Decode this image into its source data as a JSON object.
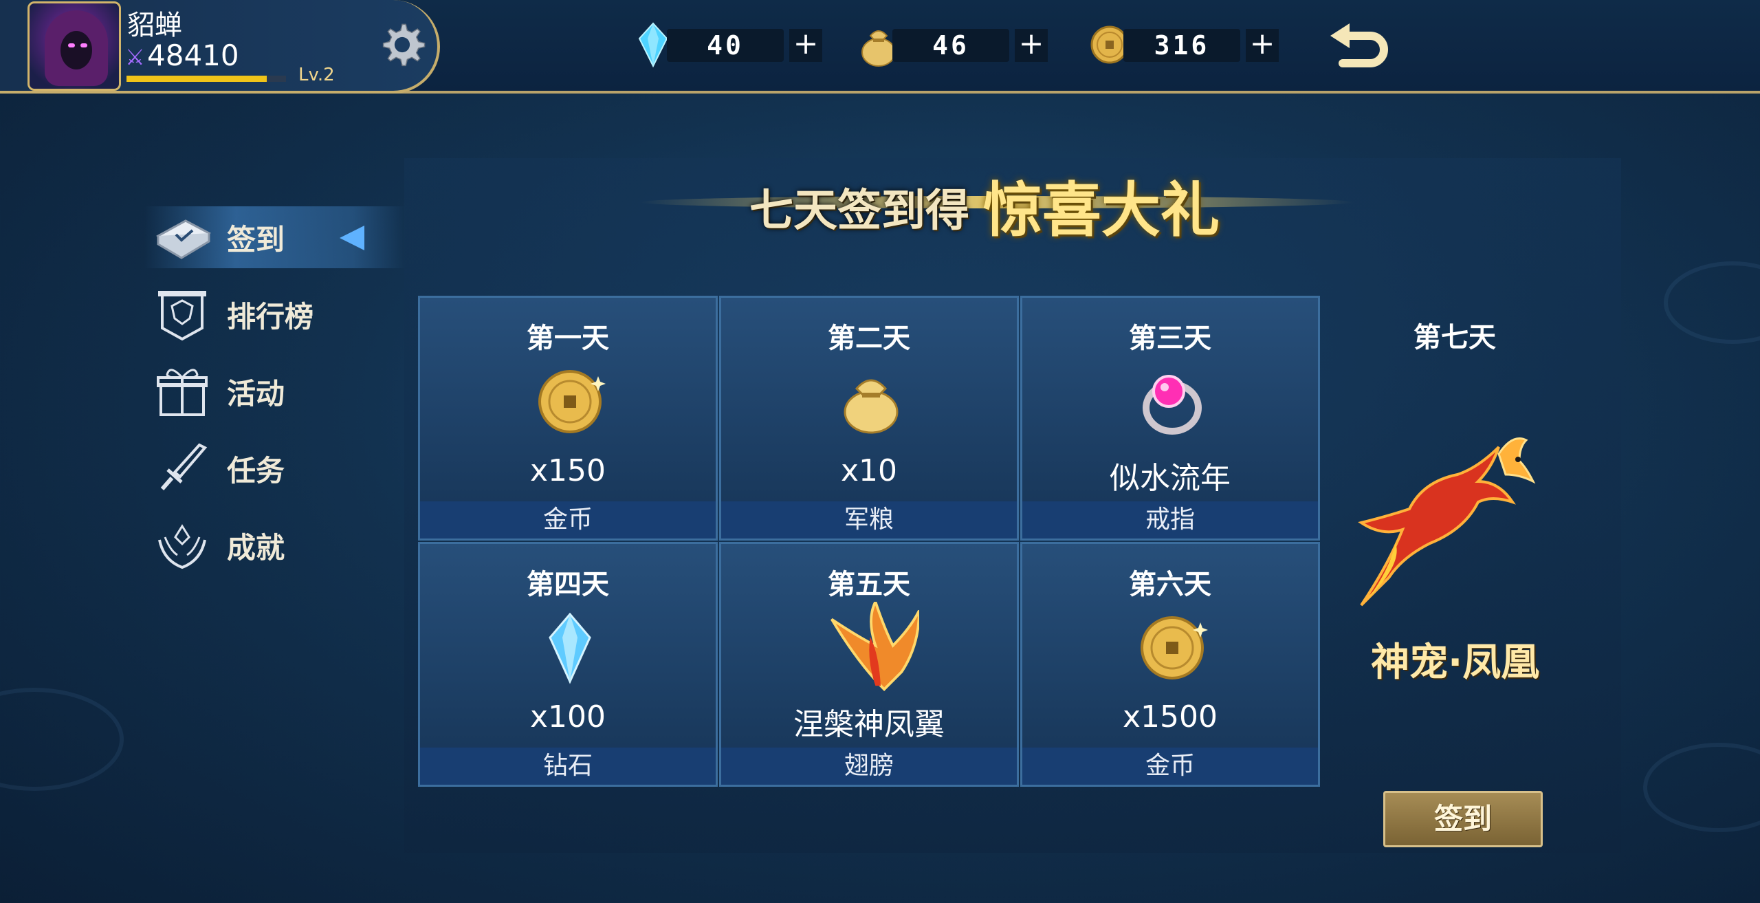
{
  "player": {
    "name": "貂蝉",
    "power": "48410",
    "level": "Lv.2",
    "xp_fraction": 0.88
  },
  "currencies": [
    {
      "icon": "diamond-icon",
      "value": "40"
    },
    {
      "icon": "grain-bag-icon",
      "value": "46"
    },
    {
      "icon": "gold-coin-icon",
      "value": "316"
    }
  ],
  "nav": {
    "items": [
      {
        "label": "签到",
        "icon": "signin-book-icon",
        "active": true
      },
      {
        "label": "排行榜",
        "icon": "ranking-banner-icon",
        "active": false
      },
      {
        "label": "活动",
        "icon": "gift-box-icon",
        "active": false
      },
      {
        "label": "任务",
        "icon": "sword-icon",
        "active": false
      },
      {
        "label": "成就",
        "icon": "laurel-crest-icon",
        "active": false
      }
    ]
  },
  "banner": {
    "small": "七天签到得",
    "big": "惊喜大礼"
  },
  "days": [
    {
      "day": "第一天",
      "amount": "x150",
      "type": "金币",
      "icon": "gold-coin-icon"
    },
    {
      "day": "第二天",
      "amount": "x10",
      "type": "军粮",
      "icon": "grain-bag-icon"
    },
    {
      "day": "第三天",
      "amount": "似水流年",
      "type": "戒指",
      "icon": "ring-icon"
    },
    {
      "day": "第四天",
      "amount": "x100",
      "type": "钻石",
      "icon": "diamond-icon"
    },
    {
      "day": "第五天",
      "amount": "涅槃神凤翼",
      "type": "翅膀",
      "icon": "phoenix-wing-icon"
    },
    {
      "day": "第六天",
      "amount": "x1500",
      "type": "金币",
      "icon": "gold-coin-icon"
    }
  ],
  "day7": {
    "day": "第七天",
    "reward": "神宠·凤凰",
    "icon": "phoenix-pet-icon"
  },
  "signin_button": "签到",
  "colors": {
    "accent_gold": "#d2b56b",
    "panel_blue": "#274f7a",
    "type_strip": "#183e72",
    "active_arrow": "#5fb2ff"
  }
}
